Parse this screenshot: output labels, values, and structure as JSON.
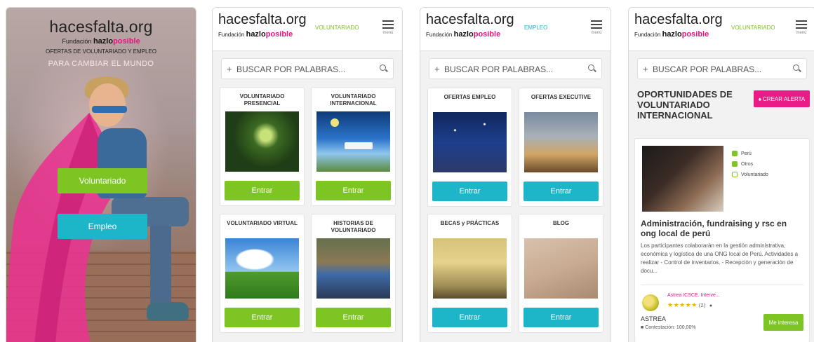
{
  "brand": {
    "name": "hacesfalta.org",
    "fundacion": "Fundación",
    "org_part1": "hazlo",
    "org_part2": "posible",
    "menu_label": "menú"
  },
  "splash": {
    "subtitle": "OFERTAS DE VOLUNTARIADO Y EMPLEO",
    "tagline": "PARA CAMBIAR EL MUNDO",
    "voluntariado_button": "Voluntariado",
    "empleo_button": "Empleo"
  },
  "search_placeholder": "BUSCAR POR PALABRAS...",
  "screen2": {
    "section": "VOLUNTARIADO",
    "cards": [
      {
        "title": "VOLUNTARIADO PRESENCIAL",
        "button": "Entrar"
      },
      {
        "title": "VOLUNTARIADO INTERNACIONAL",
        "button": "Entrar"
      },
      {
        "title": "VOLUNTARIADO VIRTUAL",
        "button": "Entrar"
      },
      {
        "title": "HISTORIAS DE VOLUNTARIADO",
        "button": "Entrar"
      }
    ]
  },
  "screen3": {
    "section": "EMPLEO",
    "cards": [
      {
        "title": "OFERTAS EMPLEO",
        "button": "Entrar"
      },
      {
        "title": "OFERTAS EXECUTIVE",
        "button": "Entrar"
      },
      {
        "title": "BECAS y PRÁCTICAS",
        "button": "Entrar"
      },
      {
        "title": "BLOG",
        "button": "Entrar"
      }
    ]
  },
  "screen4": {
    "section": "VOLUNTARIADO",
    "heading": "OPORTUNIDADES DE VOLUNTARIADO INTERNACIONAL",
    "alert_button": "CREAR ALERTA",
    "offer": {
      "tags": [
        "Perú",
        "Otros",
        "Voluntariado"
      ],
      "title": "Administración, fundraising y rsc en ong local de perú",
      "description": "Los participantes colaborarán en la gestión administrativa, económica y logística de una ONG local de Perú. Actividades a realizar - Control de inventarios. - Recepción y generación de docu...",
      "org_name": "Astrea ICSCE. Interve...",
      "rating_stars": "★★★★★",
      "rating_count": "(2)",
      "logo_text": "ASTREA",
      "contestacion": "Contestación: 100,00%",
      "interest_button": "Me interesa"
    }
  },
  "colors": {
    "green": "#7cc522",
    "cyan": "#1db5c8",
    "pink": "#e4157f"
  }
}
